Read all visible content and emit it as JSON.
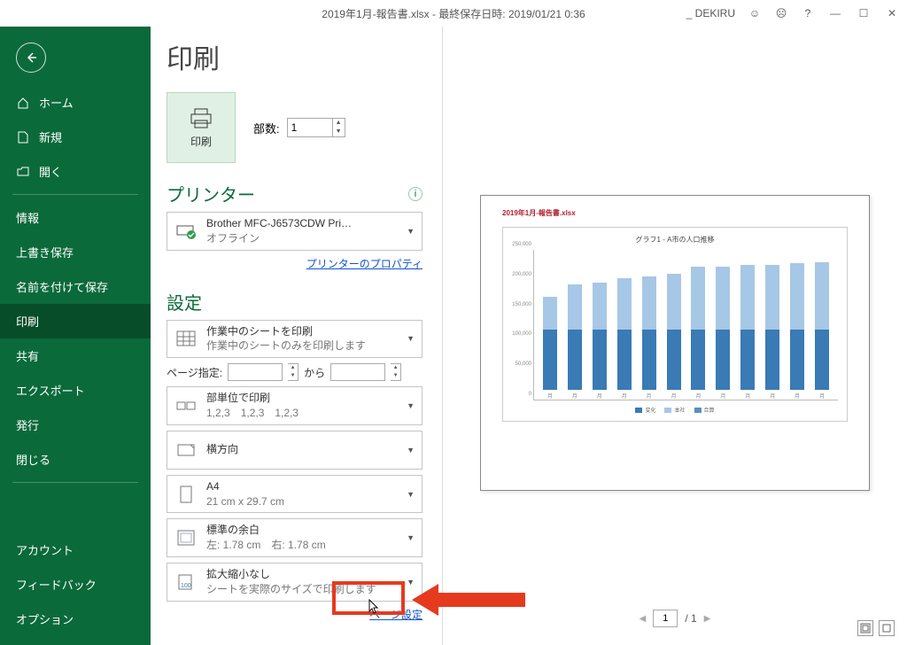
{
  "titlebar": {
    "filename": "2019年1月-報告書.xlsx - 最終保存日時: 2019/01/21 0:36",
    "user": "_ DEKIRU"
  },
  "sidebar": {
    "top": [
      {
        "icon": "home",
        "label": "ホーム"
      },
      {
        "icon": "doc",
        "label": "新規"
      },
      {
        "icon": "open",
        "label": "開く"
      }
    ],
    "mid": [
      {
        "label": "情報"
      },
      {
        "label": "上書き保存"
      },
      {
        "label": "名前を付けて保存"
      },
      {
        "label": "印刷",
        "active": true
      },
      {
        "label": "共有"
      },
      {
        "label": "エクスポート"
      },
      {
        "label": "発行"
      },
      {
        "label": "閉じる"
      }
    ],
    "bot": [
      {
        "label": "アカウント"
      },
      {
        "label": "フィードバック"
      },
      {
        "label": "オプション"
      }
    ]
  },
  "print": {
    "heading": "印刷",
    "button": "印刷",
    "copies_label": "部数:",
    "copies_value": "1",
    "printer_heading": "プリンター",
    "printer_name": "Brother MFC-J6573CDW Pri…",
    "printer_status": "オフライン",
    "printer_props": "プリンターのプロパティ",
    "settings_heading": "設定",
    "settings": {
      "what": {
        "title": "作業中のシートを印刷",
        "sub": "作業中のシートのみを印刷します"
      },
      "pages_label": "ページ指定:",
      "pages_to": "から",
      "collate": {
        "title": "部単位で印刷",
        "sub": "1,2,3　1,2,3　1,2,3"
      },
      "orient": {
        "title": "横方向"
      },
      "paper": {
        "title": "A4",
        "sub": "21 cm x 29.7 cm"
      },
      "margin": {
        "title": "標準の余白",
        "sub": "左:  1.78 cm　右:  1.78 cm"
      },
      "scale": {
        "title": "拡大縮小なし",
        "sub": "シートを実際のサイズで印刷します"
      }
    },
    "page_setup": "ページ設定"
  },
  "preview": {
    "doc_title": "2019年1月-報告書.xlsx",
    "pager_current": "1",
    "pager_sep": "/ 1"
  },
  "chart_data": {
    "type": "bar",
    "title": "グラフ1 - A市の人口推移",
    "categories": [
      "月",
      "月",
      "月",
      "月",
      "月",
      "月",
      "月",
      "月",
      "月",
      "月",
      "月",
      "月"
    ],
    "ylim": [
      0,
      250000
    ],
    "yticks": [
      "0",
      "50,000",
      "100,000",
      "150,000",
      "200,000",
      "250,000"
    ],
    "series": [
      {
        "name": "変化",
        "values": [
          100000,
          100000,
          100000,
          100000,
          100000,
          100000,
          100000,
          100000,
          100000,
          100000,
          100000,
          100000
        ],
        "color": "#3a7ab5"
      },
      {
        "name": "本社",
        "values": [
          55000,
          75000,
          78000,
          85000,
          88000,
          93000,
          105000,
          105000,
          107000,
          108000,
          110000,
          112000
        ],
        "color": "#a7c7e6"
      },
      {
        "name": "合算",
        "values": [
          155000,
          175000,
          178000,
          185000,
          188000,
          193000,
          205000,
          205000,
          207000,
          208000,
          210000,
          212000
        ],
        "color": "#5a8fbf",
        "type": "line"
      }
    ],
    "legend": [
      "変化",
      "本社",
      "合算"
    ]
  }
}
